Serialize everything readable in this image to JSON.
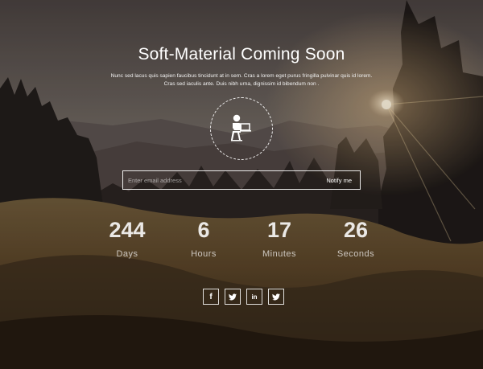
{
  "page": {
    "title": "Soft-Material Coming Soon",
    "description": "Nunc sed lacus quis sapien faucibus tincidunt at in sem. Cras a lorem eget purus fringilla pulvinar quis id lorem. Cras sed iaculis ante. Duis nibh urna, dignissim id bibendum non ."
  },
  "logo": {
    "icon": "person-at-desk-icon"
  },
  "subscribe": {
    "placeholder": "Enter email address",
    "button_label": "Notify me"
  },
  "countdown": [
    {
      "value": "244",
      "label": "Days"
    },
    {
      "value": "6",
      "label": "Hours"
    },
    {
      "value": "17",
      "label": "Minutes"
    },
    {
      "value": "26",
      "label": "Seconds"
    }
  ],
  "socials": [
    {
      "name": "facebook",
      "glyph": "f"
    },
    {
      "name": "twitter",
      "glyph": "t"
    },
    {
      "name": "linkedin",
      "glyph": "in"
    },
    {
      "name": "twitter",
      "glyph": "t"
    }
  ]
}
